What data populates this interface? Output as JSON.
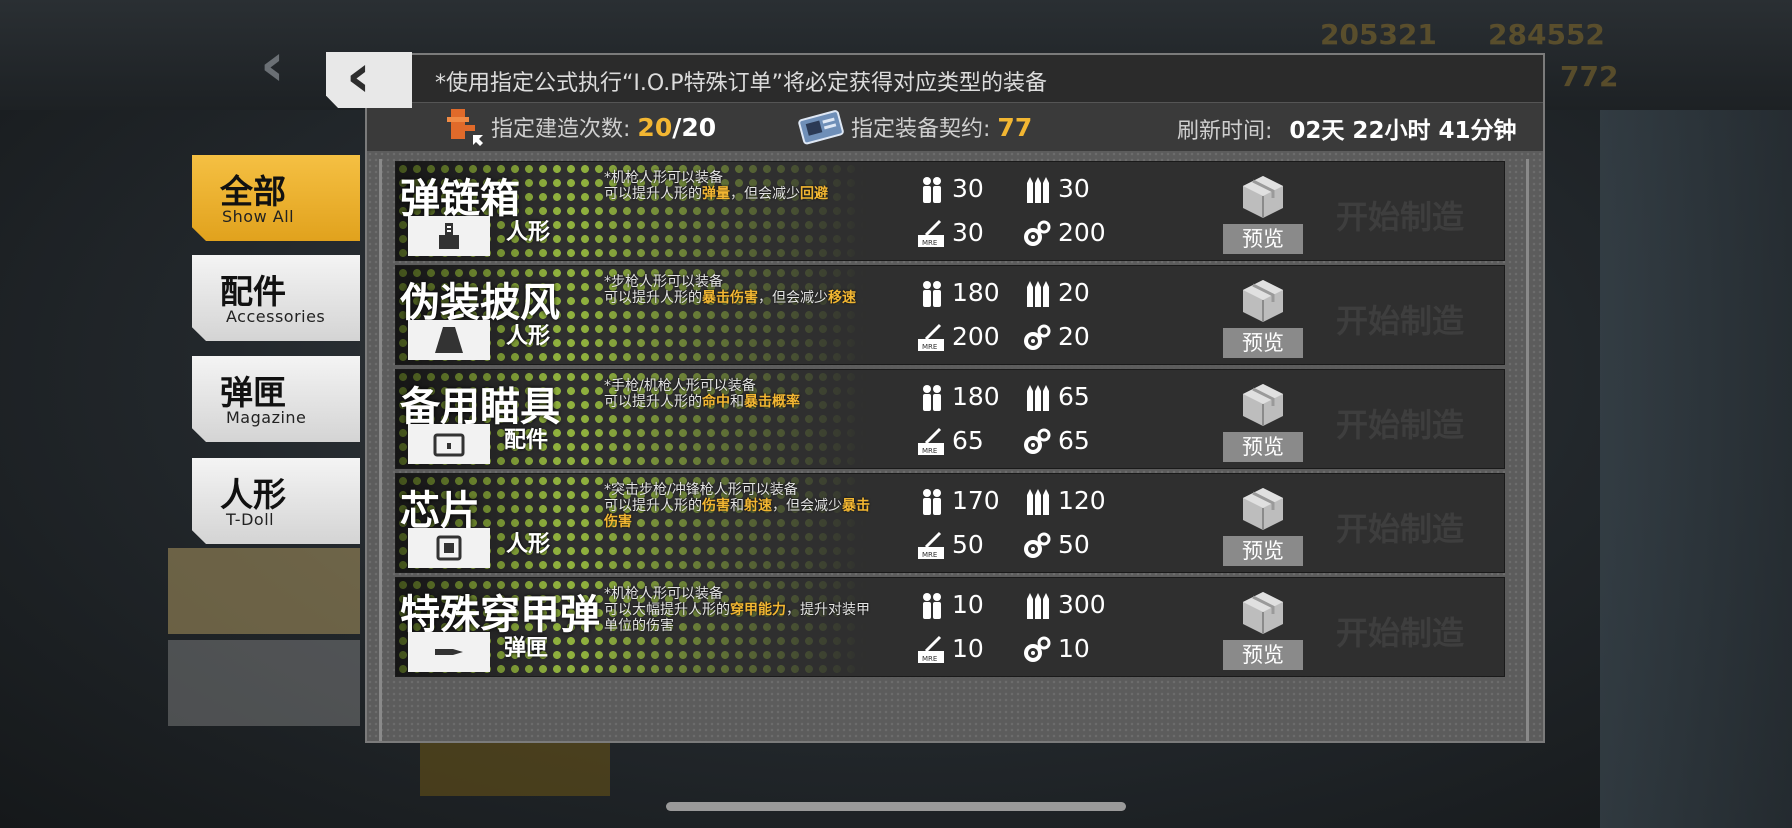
{
  "header": {
    "back_label": "‹",
    "resources": {
      "manpower": "205321",
      "ammo": "284552",
      "extra": "772"
    }
  },
  "tabs": [
    {
      "cn": "全部",
      "en": "Show All",
      "active": true
    },
    {
      "cn": "配件",
      "en": "Accessories",
      "active": false
    },
    {
      "cn": "弹匣",
      "en": "Magazine",
      "active": false
    },
    {
      "cn": "人形",
      "en": "T-Doll",
      "active": false
    }
  ],
  "dialog": {
    "notice": "*使用指定公式执行“I.O.P特殊订单”将必定获得对应类型的装备",
    "build_count_label": "指定建造次数:",
    "build_count_current": "20",
    "build_count_sep": "/",
    "build_count_max": "20",
    "contract_label": "指定装备契约:",
    "contract_value": "77",
    "refresh_label": "刷新时间:",
    "refresh_value": "02天 22小时 41分钟"
  },
  "items": [
    {
      "name": "弹链箱",
      "type": "人形",
      "icon": "ammo-box-icon",
      "desc1": "*机枪人形可以装备",
      "desc2a": "可以提升人形的",
      "desc2b": "弹量",
      "desc2c": "，但会减少",
      "desc2d": "回避",
      "desc3": "",
      "manpower": "30",
      "ammo": "30",
      "rations": "30",
      "parts": "200",
      "preview": "预览",
      "start": "开始制造"
    },
    {
      "name": "伪装披风",
      "type": "人形",
      "icon": "cape-icon",
      "desc1": "*步枪人形可以装备",
      "desc2a": "可以提升人形的",
      "desc2b": "暴击伤害",
      "desc2c": "，但会减少",
      "desc2d": "移速",
      "desc3": "",
      "manpower": "180",
      "ammo": "20",
      "rations": "200",
      "parts": "20",
      "preview": "预览",
      "start": "开始制造"
    },
    {
      "name": "备用瞄具",
      "type": "配件",
      "icon": "scope-icon",
      "desc1": "*手枪/机枪人形可以装备",
      "desc2a": "可以提升人形的",
      "desc2b": "命中",
      "desc2c": "和",
      "desc2d": "暴击概率",
      "desc3": "",
      "manpower": "180",
      "ammo": "65",
      "rations": "65",
      "parts": "65",
      "preview": "预览",
      "start": "开始制造"
    },
    {
      "name": "芯片",
      "type": "人形",
      "icon": "chip-icon",
      "desc1": "*突击步枪/冲锋枪人形可以装备",
      "desc2a": "可以提升人形的",
      "desc2b": "伤害",
      "desc2c": "和",
      "desc2d": "射速",
      "desc2e": "，但会减少",
      "desc2f": "暴击",
      "desc3": "伤害",
      "manpower": "170",
      "ammo": "120",
      "rations": "50",
      "parts": "50",
      "preview": "预览",
      "start": "开始制造"
    },
    {
      "name": "特殊穿甲弹",
      "type": "弹匣",
      "icon": "ap-round-icon",
      "desc1": "*机枪人形可以装备",
      "desc2a": "可以大幅提升人形的",
      "desc2b": "穿甲能力",
      "desc2c": "，提升对装甲",
      "desc2d": "",
      "desc3": "单位的伤害",
      "manpower": "10",
      "ammo": "300",
      "rations": "10",
      "parts": "10",
      "preview": "预览",
      "start": "开始制造"
    }
  ],
  "colors": {
    "accent": "#f2b632",
    "dots": "#8fb03d",
    "panel": "#2f2f2f"
  }
}
